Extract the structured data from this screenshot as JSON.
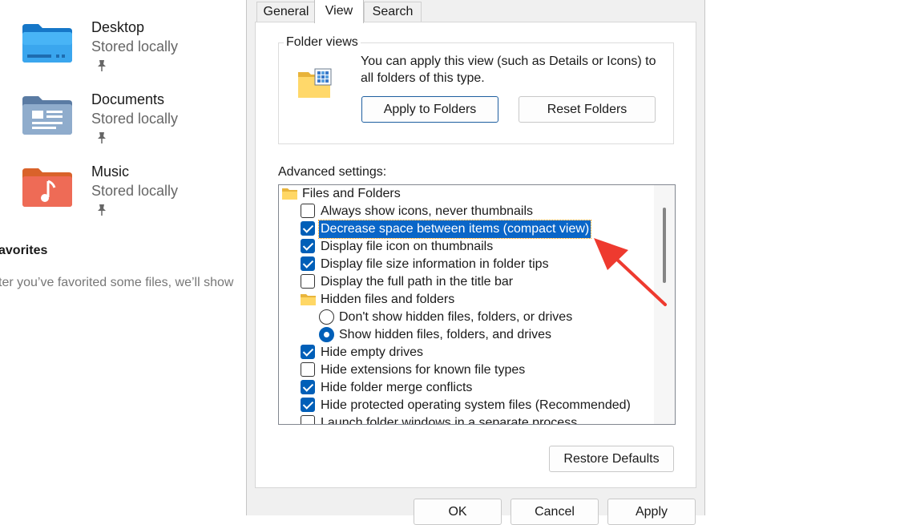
{
  "quick_access": [
    {
      "name": "Desktop",
      "status": "Stored locally"
    },
    {
      "name": "Documents",
      "status": "Stored locally"
    },
    {
      "name": "Music",
      "status": "Stored locally"
    }
  ],
  "favorites": {
    "title": "avorites",
    "empty_text": "ter you’ve favorited some files, we’ll show"
  },
  "dialog": {
    "tabs": [
      "General",
      "View",
      "Search"
    ],
    "folder_views": {
      "legend": "Folder views",
      "description": "You can apply this view (such as Details or Icons) to all folders of this type.",
      "apply_button": "Apply to Folders",
      "reset_button": "Reset Folders"
    },
    "advanced_label": "Advanced settings:",
    "tree": [
      {
        "type": "folder",
        "label": "Files and Folders"
      },
      {
        "type": "checkbox",
        "checked": false,
        "label": "Always show icons, never thumbnails"
      },
      {
        "type": "checkbox",
        "checked": true,
        "label": "Decrease space between items (compact view)",
        "selected": true
      },
      {
        "type": "checkbox",
        "checked": true,
        "label": "Display file icon on thumbnails"
      },
      {
        "type": "checkbox",
        "checked": true,
        "label": "Display file size information in folder tips"
      },
      {
        "type": "checkbox",
        "checked": false,
        "label": "Display the full path in the title bar"
      },
      {
        "type": "folder",
        "label": "Hidden files and folders"
      },
      {
        "type": "radio",
        "checked": false,
        "label": "Don't show hidden files, folders, or drives"
      },
      {
        "type": "radio",
        "checked": true,
        "label": "Show hidden files, folders, and drives"
      },
      {
        "type": "checkbox",
        "checked": true,
        "label": "Hide empty drives"
      },
      {
        "type": "checkbox",
        "checked": false,
        "label": "Hide extensions for known file types"
      },
      {
        "type": "checkbox",
        "checked": true,
        "label": "Hide folder merge conflicts"
      },
      {
        "type": "checkbox",
        "checked": true,
        "label": "Hide protected operating system files (Recommended)"
      },
      {
        "type": "checkbox",
        "checked": false,
        "label": "Launch folder windows in a separate process"
      }
    ],
    "restore_button": "Restore Defaults",
    "footer_buttons": [
      "OK",
      "Cancel",
      "Apply"
    ]
  },
  "colors": {
    "accent": "#005fb8",
    "selection": "#0a66c8",
    "annotation_arrow": "#ee3a2f"
  },
  "icons": {
    "folder": "folder-icon",
    "pin": "pin-icon",
    "folder_views": "folder-views-icon"
  }
}
